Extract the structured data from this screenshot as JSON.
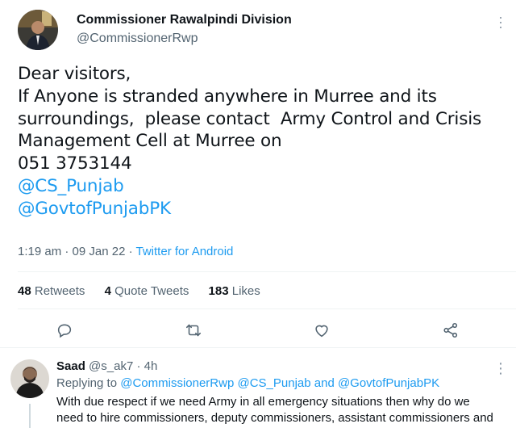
{
  "tweet": {
    "author_name": "Commissioner Rawalpindi Division",
    "author_handle": "@CommissionerRwp",
    "lines": {
      "l1": "Dear visitors,",
      "l2": "If Anyone is stranded anywhere in Murree and its",
      "l3": "surroundings,  please contact  Army Control and Crisis",
      "l4": "Management Cell at Murree on",
      "l5": "051 3753144"
    },
    "mentions": [
      "@CS_Punjab",
      "@GovtofPunjabPK"
    ],
    "time": "1:19 am",
    "date": "09 Jan 22",
    "source": "Twitter for Android"
  },
  "stats": {
    "retweets_count": "48",
    "retweets_label": "Retweets",
    "quotes_count": "4",
    "quotes_label": "Quote Tweets",
    "likes_count": "183",
    "likes_label": "Likes"
  },
  "actions": [
    "reply-icon",
    "retweet-icon",
    "like-icon",
    "share-icon"
  ],
  "reply": {
    "name": "Saad",
    "handle": "@s_ak7",
    "time": "4h",
    "replying_prefix": "Replying to",
    "replying_to": "@CommissionerRwp @CS_Punjab and @GovtofPunjabPK",
    "line1": "With due respect if we need Army in all emergency situations then why do we",
    "line2": "need to hire commissioners, deputy commissioners, assistant commissioners and"
  },
  "colors": {
    "accent": "#1d9bf0",
    "secondary_text": "#536471",
    "text": "#0f1419"
  }
}
